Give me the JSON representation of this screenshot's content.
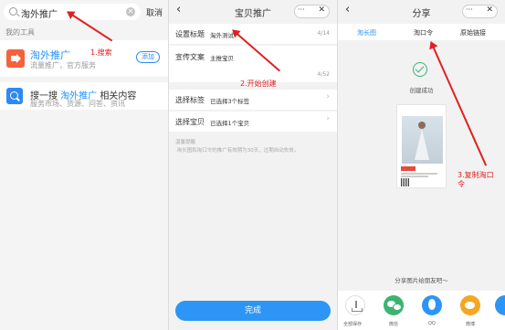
{
  "panel1": {
    "search_value": "淘外推广",
    "clear_icon": "✕",
    "cancel_label": "取消",
    "section_label": "我的工具",
    "tool": {
      "title": "淘外推广",
      "subtitle": "流量推广，官方服务",
      "add_label": "添加",
      "icon": "megaphone-icon"
    },
    "search_more": {
      "prefix": "搜一搜 ",
      "highlight": "淘外推广",
      "suffix": " 相关内容",
      "subtitle": "服务市场、货源、问答、资讯",
      "icon": "search-icon"
    }
  },
  "panel2": {
    "back_icon": "‹",
    "title": "宝贝推广",
    "dots": "···",
    "close": "✕",
    "rows": {
      "title_label": "设置标题",
      "title_value": "淘外测试",
      "title_count": "4/14",
      "copy_label": "宣传文案",
      "copy_value": "主推宝贝",
      "copy_count": "4/52",
      "tags_label": "选择标签",
      "tags_value": "已选择3个标签",
      "items_label": "选择宝贝",
      "items_value": "已选择1个宝贝"
    },
    "hint_title": "温馨提醒",
    "hint_text": "·淘长图和淘口令的推广有效期为30天，过期自动失效。",
    "done_label": "完成",
    "chevron": "›"
  },
  "panel3": {
    "back_icon": "‹",
    "title": "分享",
    "dots": "···",
    "close": "✕",
    "tabs": [
      "淘长图",
      "淘口令",
      "原始链接"
    ],
    "success_text": "创建成功",
    "share_tip": "分享图片给朋友吧～",
    "share_items": [
      {
        "label": "全部保存",
        "icon": "download-icon"
      },
      {
        "label": "微信",
        "icon": "wechat-icon"
      },
      {
        "label": "QQ",
        "icon": "qq-icon"
      },
      {
        "label": "微博",
        "icon": "weibo-icon"
      }
    ]
  },
  "annotations": {
    "a1": "1.搜索",
    "a2": "2.开始创建",
    "a3_line1": "3.复制淘口",
    "a3_line2": "令"
  },
  "colors": {
    "accent": "#2d95f5",
    "annotation": "#e02020",
    "orange": "#f5623a",
    "success": "#3cb371"
  }
}
